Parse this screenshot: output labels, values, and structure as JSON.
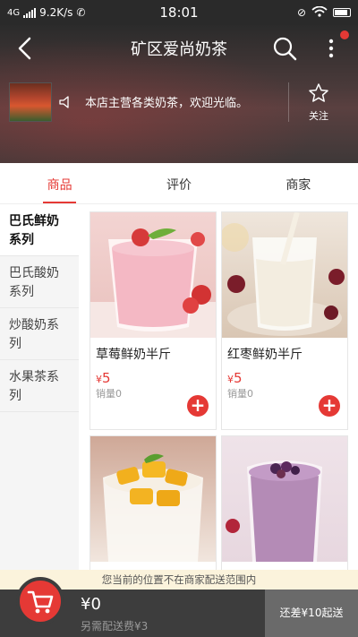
{
  "statusbar": {
    "network": "4G",
    "speed": "9.2K/s",
    "time": "18:01"
  },
  "header": {
    "title": "矿区爱尚奶茶",
    "notice": "本店主营各类奶茶，欢迎光临。",
    "follow_label": "关注"
  },
  "tabs": [
    {
      "label": "商品",
      "active": true
    },
    {
      "label": "评价",
      "active": false
    },
    {
      "label": "商家",
      "active": false
    }
  ],
  "sidebar": {
    "items": [
      {
        "label": "巴氏鲜奶系列",
        "active": true
      },
      {
        "label": "巴氏酸奶系列",
        "active": false
      },
      {
        "label": "炒酸奶系列",
        "active": false
      },
      {
        "label": "水果茶系列",
        "active": false
      }
    ]
  },
  "products": [
    {
      "name": "草莓鲜奶半斤",
      "currency": "¥",
      "price": "5",
      "sold": "销量0"
    },
    {
      "name": "红枣鲜奶半斤",
      "currency": "¥",
      "price": "5",
      "sold": "销量0"
    },
    {
      "name": "",
      "currency": "",
      "price": "",
      "sold": ""
    },
    {
      "name": "",
      "currency": "",
      "price": "",
      "sold": ""
    }
  ],
  "banner": {
    "text": "您当前的位置不在商家配送范围内"
  },
  "footer": {
    "total": "¥0",
    "delivery_fee": "另需配送费¥3",
    "min_order": "还差¥10起送"
  },
  "colors": {
    "accent": "#e53935",
    "footer_bg": "#3d3d3d",
    "banner_bg": "#fbf3dc"
  }
}
